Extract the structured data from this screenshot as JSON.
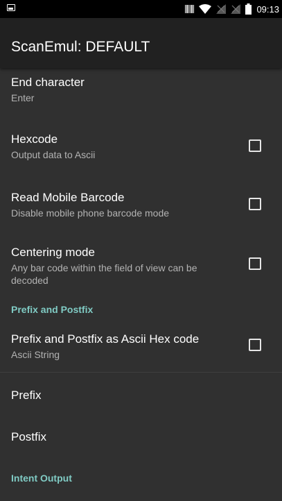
{
  "status_bar": {
    "time": "09:13"
  },
  "app_bar": {
    "title": "ScanEmul: DEFAULT"
  },
  "preferences": {
    "end_character": {
      "title": "End character",
      "summary": "Enter"
    },
    "hexcode": {
      "title": "Hexcode",
      "summary": "Output data to Ascii",
      "checked": false
    },
    "read_mobile_barcode": {
      "title": "Read Mobile Barcode",
      "summary": "Disable mobile phone barcode mode",
      "checked": false
    },
    "centering_mode": {
      "title": "Centering mode",
      "summary": "Any bar code within the field of view can be decoded",
      "checked": false
    },
    "category_prefix": {
      "label": "Prefix and Postfix"
    },
    "prefix_postfix_hex": {
      "title": "Prefix and Postfix as Ascii Hex code",
      "summary": "Ascii String",
      "checked": false
    },
    "prefix": {
      "title": "Prefix"
    },
    "postfix": {
      "title": "Postfix"
    },
    "category_intent": {
      "label": "Intent Output"
    }
  }
}
